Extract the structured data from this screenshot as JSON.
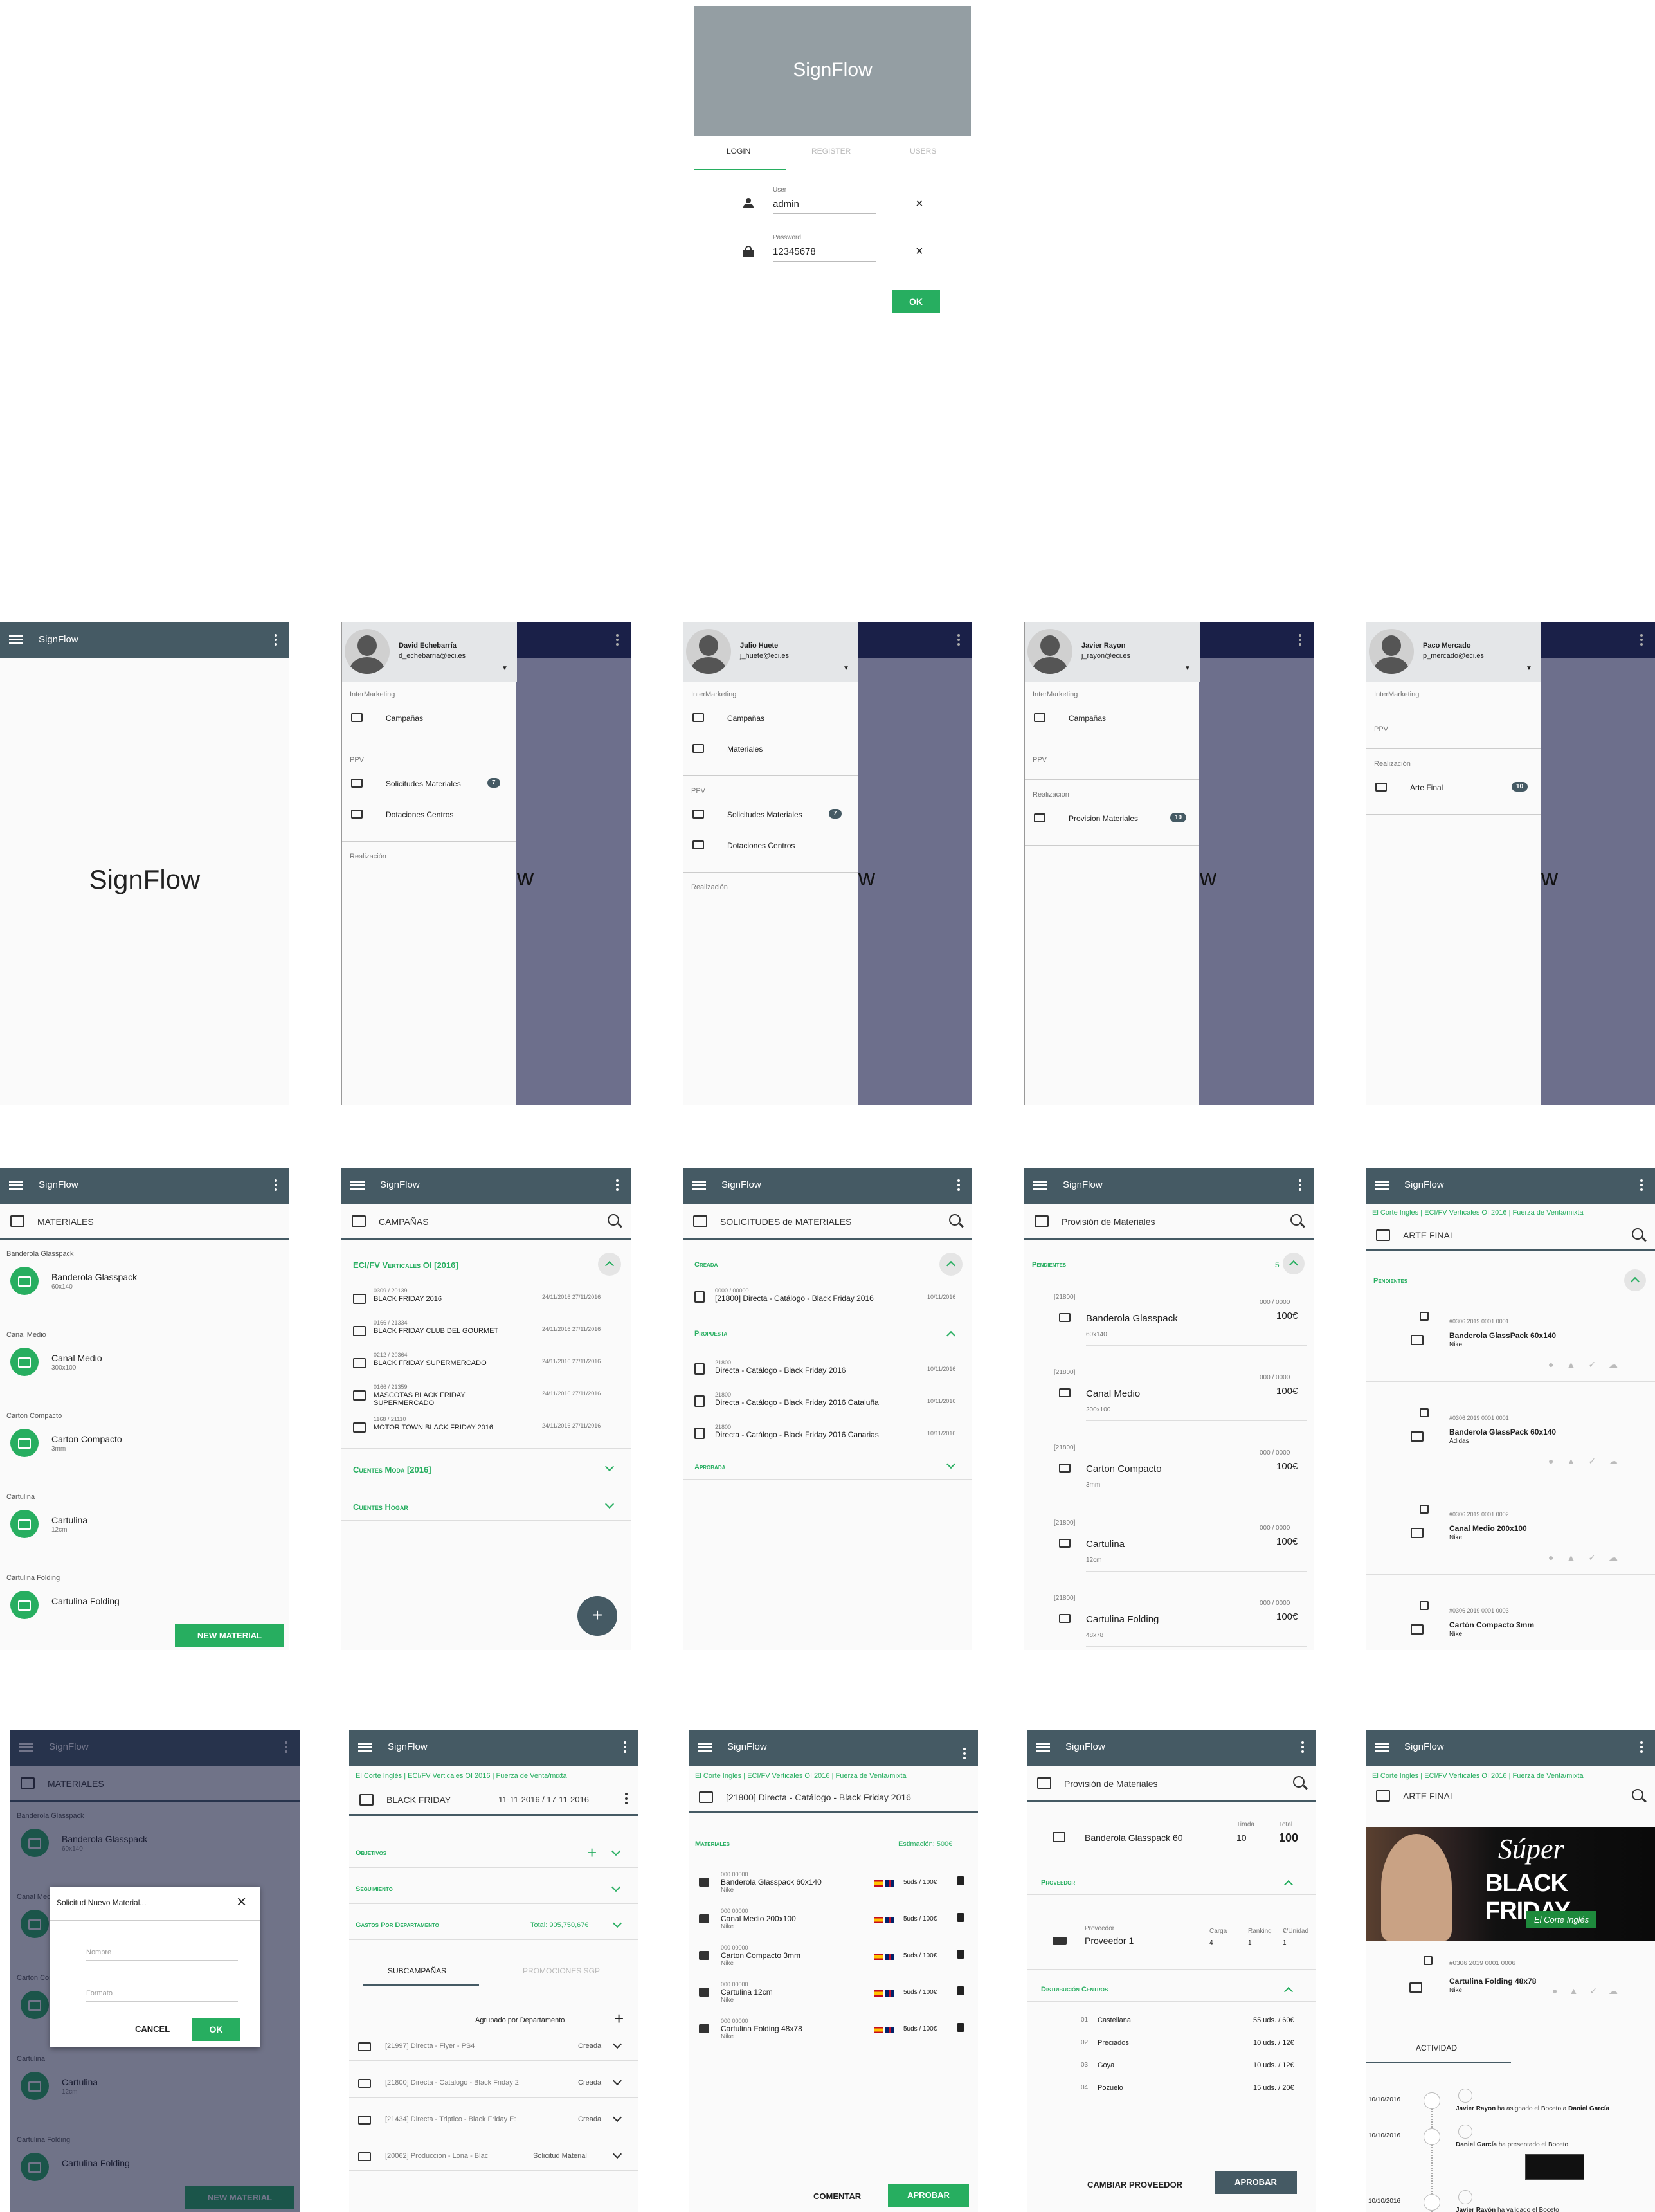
{
  "app": "SignFlow",
  "login": {
    "tabs": [
      "LOGIN",
      "REGISTER",
      "USERS"
    ],
    "user_label": "User",
    "user_value": "admin",
    "password_label": "Password",
    "password_value": "12345678",
    "ok": "OK"
  },
  "splash": {
    "title": "SignFlow"
  },
  "drawers": [
    {
      "name": "David Echebarría",
      "email": "d_echebarria@eci.es",
      "sections": [
        {
          "title": "InterMarketing",
          "items": [
            {
              "label": "Campañas"
            }
          ]
        },
        {
          "title": "PPV",
          "items": [
            {
              "label": "Solicitudes Materiales",
              "badge": "7"
            },
            {
              "label": "Dotaciones Centros"
            }
          ]
        },
        {
          "title": "Realización",
          "items": []
        }
      ]
    },
    {
      "name": "Julio Huete",
      "email": "j_huete@eci.es",
      "sections": [
        {
          "title": "InterMarketing",
          "items": [
            {
              "label": "Campañas"
            },
            {
              "label": "Materiales"
            }
          ]
        },
        {
          "title": "PPV",
          "items": [
            {
              "label": "Solicitudes Materiales",
              "badge": "7"
            },
            {
              "label": "Dotaciones Centros"
            }
          ]
        },
        {
          "title": "Realización",
          "items": []
        }
      ]
    },
    {
      "name": "Javier Rayon",
      "email": "j_rayon@eci.es",
      "sections": [
        {
          "title": "InterMarketing",
          "items": [
            {
              "label": "Campañas"
            }
          ]
        },
        {
          "title": "PPV",
          "items": []
        },
        {
          "title": "Realización",
          "items": [
            {
              "label": "Provision Materiales",
              "badge": "10"
            }
          ]
        }
      ]
    },
    {
      "name": "Paco Mercado",
      "email": "p_mercado@eci.es",
      "sections": [
        {
          "title": "InterMarketing",
          "items": []
        },
        {
          "title": "PPV",
          "items": []
        },
        {
          "title": "Realización",
          "items": [
            {
              "label": "Arte Final",
              "badge": "10"
            }
          ]
        }
      ]
    }
  ],
  "materiales": {
    "title": "MATERIALES",
    "groups": [
      {
        "group": "Banderola Glasspack",
        "name": "Banderola Glasspack",
        "size": "60x140"
      },
      {
        "group": "Canal Medio",
        "name": "Canal Medio",
        "size": "300x100"
      },
      {
        "group": "Carton Compacto",
        "name": "Carton Compacto",
        "size": "3mm"
      },
      {
        "group": "Cartulina",
        "name": "Cartulina",
        "size": "12cm"
      },
      {
        "group": "Cartulina Folding",
        "name": "Cartulina Folding",
        "size": ""
      }
    ],
    "new_button": "NEW MATERIAL"
  },
  "campanas": {
    "title": "CAMPAÑAS",
    "section1": "ECI/FV Verticales OI [2016]",
    "items": [
      {
        "code": "0309 / 20139",
        "name": "BLACK FRIDAY 2016",
        "dates": "24/11/2016 27/11/2016"
      },
      {
        "code": "0166 / 21334",
        "name": "BLACK FRIDAY CLUB DEL GOURMET",
        "dates": "24/11/2016 27/11/2016"
      },
      {
        "code": "0212 / 20364",
        "name": "BLACK FRIDAY SUPERMERCADO",
        "dates": "24/11/2016 27/11/2016"
      },
      {
        "code": "0166 / 21359",
        "name": "MASCOTAS BLACK FRIDAY SUPERMERCADO",
        "dates": "24/11/2016 27/11/2016"
      },
      {
        "code": "1168 / 21110",
        "name": "MOTOR TOWN BLACK FRIDAY 2016",
        "dates": "24/11/2016 27/11/2016"
      }
    ],
    "section2": "Cuentes Moda [2016]",
    "section3": "Cuentes Hogar",
    "fab": "+"
  },
  "solicitudes": {
    "title": "SOLICITUDES de MATERIALES",
    "creada": "Creada",
    "creada_items": [
      {
        "code": "0000 / 00000",
        "name": "[21800] Directa - Catálogo - Black Friday 2016",
        "date": "10/11/2016"
      }
    ],
    "propuesta": "Propuesta",
    "propuesta_items": [
      {
        "code": "21800",
        "name": "Directa - Catálogo - Black Friday 2016",
        "date": "10/11/2016"
      },
      {
        "code": "21800",
        "name": "Directa - Catálogo - Black Friday 2016 Cataluña",
        "date": "10/11/2016"
      },
      {
        "code": "21800",
        "name": "Directa - Catálogo - Black Friday 2016 Canarias",
        "date": "10/11/2016"
      }
    ],
    "aprobada": "Aprobada"
  },
  "provision": {
    "title": "Provisión de Materiales",
    "pendientes": "Pendientes",
    "count": "5",
    "items": [
      {
        "code": "[21800]",
        "name": "Banderola Glasspack",
        "size": "60x140",
        "qty": "000 / 0000",
        "price": "100€"
      },
      {
        "code": "[21800]",
        "name": "Canal Medio",
        "size": "200x100",
        "qty": "000 / 0000",
        "price": "100€"
      },
      {
        "code": "[21800]",
        "name": "Carton Compacto",
        "size": "3mm",
        "qty": "000 / 0000",
        "price": "100€"
      },
      {
        "code": "[21800]",
        "name": "Cartulina",
        "size": "12cm",
        "qty": "000 / 0000",
        "price": "100€"
      },
      {
        "code": "[21800]",
        "name": "Cartulina Folding",
        "size": "48x78",
        "qty": "000 / 0000",
        "price": "100€"
      }
    ]
  },
  "arte": {
    "crumbs": [
      "El Corte Inglés",
      "ECI/FV Verticales OI 2016",
      "Fuerza de Venta/mixta"
    ],
    "title": "ARTE FINAL",
    "pendientes": "Pendientes",
    "items": [
      {
        "code": "#0306 2019 0001 0001",
        "name": "Banderola GlassPack 60x140",
        "brand": "Nike"
      },
      {
        "code": "#0306 2019 0001 0001",
        "name": "Banderola GlassPack 60x140",
        "brand": "Adidas"
      },
      {
        "code": "#0306 2019 0001 0002",
        "name": "Canal Medio 200x100",
        "brand": "Nike"
      },
      {
        "code": "#0306 2019 0001 0003",
        "name": "Cartón Compacto 3mm",
        "brand": "Nike"
      }
    ]
  },
  "dialog": {
    "title": "Solicitud Nuevo Material...",
    "nombre": "Nombre",
    "formato": "Formato",
    "cancel": "CANCEL",
    "ok": "OK"
  },
  "bf": {
    "crumbs": [
      "El Corte Inglés",
      "ECI/FV Verticales OI 2016",
      "Fuerza de Venta/mixta"
    ],
    "title": "BLACK FRIDAY",
    "dates": "11-11-2016 / 17-11-2016",
    "objetivos": "Objetivos",
    "seguimiento": "Seguimiento",
    "gastos": "Gastos Por Departamento",
    "total": "Total: 905,750,67€",
    "tab1": "SUBCAMPAÑAS",
    "tab2": "PROMOCIONES SGP",
    "agrupado": "Agrupado por Departamento",
    "rows": [
      {
        "name": "[21997] Directa - Flyer - PS4",
        "status": "Creada"
      },
      {
        "name": "[21800] Directa - Catalogo - Black Friday 2",
        "status": "Creada"
      },
      {
        "name": "[21434] Directa - Triptico - Black Friday E:",
        "status": "Creada"
      },
      {
        "name": "[20062] Produccion - Lona - Blac",
        "status": "Solicitud Material"
      }
    ]
  },
  "detalle": {
    "crumbs": [
      "El Corte Inglés",
      "ECI/FV Verticales OI 2016",
      "Fuerza de Venta/mixta"
    ],
    "title": "[21800] Directa - Catálogo - Black Friday 2016",
    "materiales": "Materiales",
    "estimacion": "Estimación: 500€",
    "items": [
      {
        "code": "000 00000",
        "name": "Banderola Glasspack 60x140",
        "brand": "Nike",
        "qty": "5uds / 100€"
      },
      {
        "code": "000 00000",
        "name": "Canal Medio 200x100",
        "brand": "Nike",
        "qty": "5uds / 100€"
      },
      {
        "code": "000 00000",
        "name": "Carton Compacto 3mm",
        "brand": "Nike",
        "qty": "5uds / 100€"
      },
      {
        "code": "000 00000",
        "name": "Cartulina 12cm",
        "brand": "Nike",
        "qty": "5uds / 100€"
      },
      {
        "code": "000 00000",
        "name": "Cartulina Folding 48x78",
        "brand": "Nike",
        "qty": "5uds / 100€"
      }
    ],
    "comentar": "COMENTAR",
    "aprobar": "APROBAR"
  },
  "prov_det": {
    "title": "Provisión de Materiales",
    "item": "Banderola Glasspack 60",
    "tirada_l": "Tirada",
    "tirada": "10",
    "total_l": "Total",
    "total": "100",
    "proveedor": "Proveedor",
    "prov_label": "Proveedor",
    "prov_name": "Proveedor 1",
    "carga_l": "Carga",
    "carga": "4",
    "ranking_l": "Ranking",
    "ranking": "1",
    "unidad_l": "€/Unidad",
    "unidad": "1",
    "distrib": "Distribución Centros",
    "centros": [
      {
        "n": "01",
        "name": "Castellana",
        "v": "55 uds. / 60€"
      },
      {
        "n": "02",
        "name": "Preciados",
        "v": "10 uds. / 12€"
      },
      {
        "n": "03",
        "name": "Goya",
        "v": "10 uds. / 12€"
      },
      {
        "n": "04",
        "name": "Pozuelo",
        "v": "15 uds. / 20€"
      }
    ],
    "cambiar": "CAMBIAR PROVEEDOR",
    "aprobar": "APROBAR"
  },
  "arte_det": {
    "crumbs": [
      "El Corte Inglés",
      "ECI/FV Verticales OI 2016",
      "Fuerza de Venta/mixta"
    ],
    "title": "ARTE FINAL",
    "banner1": "Súper",
    "banner2": "BLACK FRIDAY",
    "banner3": "El Corte Inglés",
    "code": "#0306 2019 0001 0006",
    "name": "Cartulina Folding 48x78",
    "brand": "Nike",
    "actividad": "ACTIVIDAD",
    "events": [
      {
        "date": "10/10/2016",
        "who": "Javier Rayon",
        "text": "ha asignado el Boceto a",
        "who2": "Daniel García"
      },
      {
        "date": "10/10/2016",
        "who": "Daniel García",
        "text": "ha presentado el Boceto",
        "who2": ""
      },
      {
        "date": "10/10/2016",
        "who": "Javier Rayón",
        "text": "ha validado el Boceto",
        "who2": ""
      }
    ]
  },
  "colors": {
    "appbar": "#455a64",
    "accent": "#27ae60",
    "drawer_bg": "#1a2048",
    "overlay": "#6d6f8c"
  }
}
